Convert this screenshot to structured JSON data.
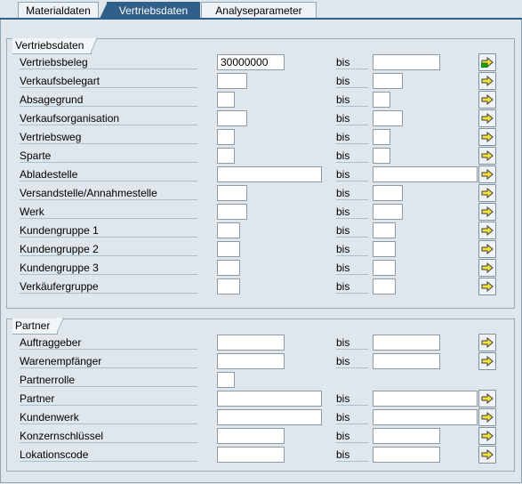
{
  "tabs": [
    {
      "label": "Materialdaten",
      "active": false
    },
    {
      "label": "Vertriebsdaten",
      "active": true
    },
    {
      "label": "Analyseparameter",
      "active": false
    }
  ],
  "bis_label": "bis",
  "vertriebsdaten": {
    "title": "Vertriebsdaten",
    "rows": [
      {
        "label": "Vertriebsbeleg",
        "from": "30000000",
        "to": "",
        "button_icon": "multiple-selection-active-icon"
      },
      {
        "label": "Verkaufsbelegart",
        "from": "",
        "to": "",
        "button_icon": "multiple-selection-icon"
      },
      {
        "label": "Absagegrund",
        "from": "",
        "to": "",
        "button_icon": "multiple-selection-icon"
      },
      {
        "label": "Verkaufsorganisation",
        "from": "",
        "to": "",
        "button_icon": "multiple-selection-icon"
      },
      {
        "label": "Vertriebsweg",
        "from": "",
        "to": "",
        "button_icon": "multiple-selection-icon"
      },
      {
        "label": "Sparte",
        "from": "",
        "to": "",
        "button_icon": "multiple-selection-icon"
      },
      {
        "label": "Abladestelle",
        "from": "",
        "to": "",
        "button_icon": "multiple-selection-icon"
      },
      {
        "label": "Versandstelle/Annahmestelle",
        "from": "",
        "to": "",
        "button_icon": "multiple-selection-icon"
      },
      {
        "label": "Werk",
        "from": "",
        "to": "",
        "button_icon": "multiple-selection-icon"
      },
      {
        "label": "Kundengruppe 1",
        "from": "",
        "to": "",
        "button_icon": "multiple-selection-icon"
      },
      {
        "label": "Kundengruppe 2",
        "from": "",
        "to": "",
        "button_icon": "multiple-selection-icon"
      },
      {
        "label": "Kundengruppe 3",
        "from": "",
        "to": "",
        "button_icon": "multiple-selection-icon"
      },
      {
        "label": "Verkäufergruppe",
        "from": "",
        "to": "",
        "button_icon": "multiple-selection-icon"
      }
    ]
  },
  "partner": {
    "title": "Partner",
    "rows": [
      {
        "label": "Auftraggeber",
        "from": "",
        "to": "",
        "button_icon": "multiple-selection-icon"
      },
      {
        "label": "Warenempfänger",
        "from": "",
        "to": "",
        "button_icon": "multiple-selection-icon"
      },
      {
        "label": "Partnerrolle",
        "from": ""
      },
      {
        "label": "Partner",
        "from": "",
        "to": "",
        "button_icon": "multiple-selection-icon"
      },
      {
        "label": "Kundenwerk",
        "from": "",
        "to": "",
        "button_icon": "multiple-selection-icon"
      },
      {
        "label": "Konzernschlüssel",
        "from": "",
        "to": "",
        "button_icon": "multiple-selection-icon"
      },
      {
        "label": "Lokationscode",
        "from": "",
        "to": "",
        "button_icon": "multiple-selection-icon"
      }
    ]
  }
}
